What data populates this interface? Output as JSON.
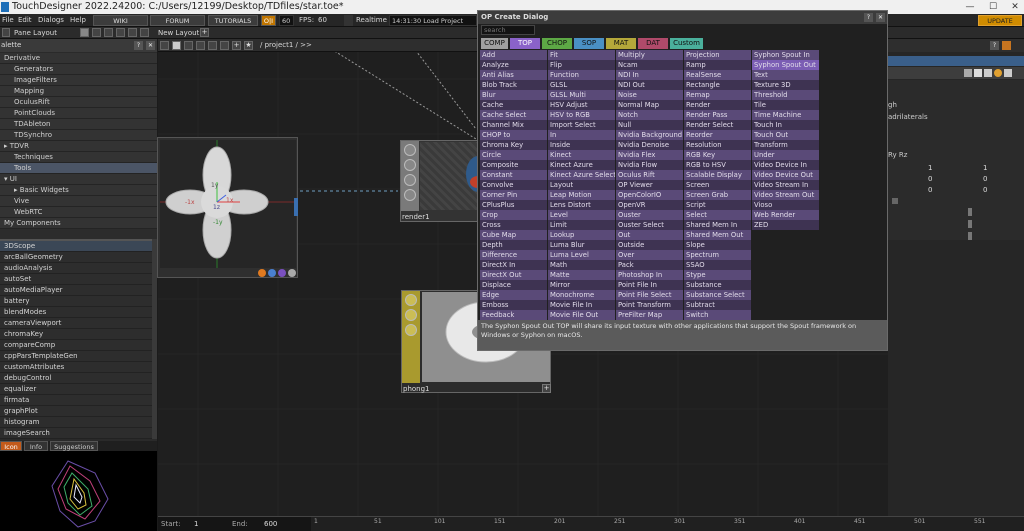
{
  "window": {
    "title": "TouchDesigner 2022.24200: C:/Users/12199/Desktop/TDfiles/star.toe*",
    "minimize": "—",
    "maximize": "☐"
  },
  "menubar": {
    "items": [
      "File",
      "Edit",
      "Dialogs",
      "Help"
    ],
    "wiki": "WIKI",
    "forum": "FORUM",
    "tutorials": "TUTORIALS",
    "oi": "O|I",
    "fps_box": "60",
    "fps": "FPS:",
    "fps_value": "60",
    "realtime": "Realtime",
    "clock": "14:31:30 Load Project .toe",
    "update": "UPDATE"
  },
  "panebar": {
    "pane_layout": "Pane Layout",
    "new_layout": "New Layout",
    "path": "/ project1 / >>"
  },
  "palette": {
    "title": "alette",
    "tree": [
      {
        "label": "Derivative",
        "indent": 0
      },
      {
        "label": "Generators",
        "indent": 1
      },
      {
        "label": "ImageFilters",
        "indent": 1
      },
      {
        "label": "Mapping",
        "indent": 1
      },
      {
        "label": "OculusRift",
        "indent": 1
      },
      {
        "label": "PointClouds",
        "indent": 1
      },
      {
        "label": "TDAbleton",
        "indent": 1
      },
      {
        "label": "TDSynchro",
        "indent": 1
      },
      {
        "label": "▸ TDVR",
        "indent": 0
      },
      {
        "label": "Techniques",
        "indent": 1
      },
      {
        "label": "Tools",
        "indent": 1
      },
      {
        "label": "▾ UI",
        "indent": 0
      },
      {
        "label": "▸ Basic Widgets",
        "indent": 1
      },
      {
        "label": "Vive",
        "indent": 1
      },
      {
        "label": "WebRTC",
        "indent": 1
      },
      {
        "label": "My Components",
        "indent": 0
      }
    ],
    "components": [
      "3DScope",
      "arcBallGeometry",
      "audioAnalysis",
      "autoSet",
      "autoMediaPlayer",
      "battery",
      "blendModes",
      "cameraViewport",
      "chromaKey",
      "compareComp",
      "cppParsTemplateGen",
      "customAttributes",
      "debugControl",
      "equalizer",
      "firmata",
      "graphPlot",
      "histogram",
      "imageSearch"
    ],
    "tabs": [
      "Icon",
      "Info",
      "Suggestions"
    ]
  },
  "nodes": {
    "render": "render1",
    "phong": "phong1",
    "axis_labels": [
      "1y",
      "-1x",
      "1z",
      "-1y",
      "1x"
    ]
  },
  "dialog": {
    "title": "OP Create Dialog",
    "search_placeholder": "search",
    "tabs": [
      "COMP",
      "TOP",
      "CHOP",
      "SOP",
      "MAT",
      "DAT",
      "Custom"
    ],
    "columns": [
      [
        "Add",
        "Analyze",
        "Anti Alias",
        "Blob Track",
        "Blur",
        "Cache",
        "Cache Select",
        "Channel Mix",
        "CHOP to",
        "Chroma Key",
        "Circle",
        "Composite",
        "Constant",
        "Convolve",
        "Corner Pin",
        "CPlusPlus",
        "Crop",
        "Cross",
        "Cube Map",
        "Depth",
        "Difference",
        "DirectX In",
        "DirectX Out",
        "Displace",
        "Edge",
        "Emboss",
        "Feedback"
      ],
      [
        "Fit",
        "Flip",
        "Function",
        "GLSL",
        "GLSL Multi",
        "HSV Adjust",
        "HSV to RGB",
        "Import Select",
        "In",
        "Inside",
        "Kinect",
        "Kinect Azure",
        "Kinect Azure Select",
        "Layout",
        "Leap Motion",
        "Lens Distort",
        "Level",
        "Limit",
        "Lookup",
        "Luma Blur",
        "Luma Level",
        "Math",
        "Matte",
        "Mirror",
        "Monochrome",
        "Movie File In",
        "Movie File Out"
      ],
      [
        "Multiply",
        "Ncam",
        "NDI In",
        "NDI Out",
        "Noise",
        "Normal Map",
        "Notch",
        "Null",
        "Nvidia Background",
        "Nvidia Denoise",
        "Nvidia Flex",
        "Nvidia Flow",
        "Oculus Rift",
        "OP Viewer",
        "OpenColorIO",
        "OpenVR",
        "Ouster",
        "Ouster Select",
        "Out",
        "Outside",
        "Over",
        "Pack",
        "Photoshop In",
        "Point File In",
        "Point File Select",
        "Point Transform",
        "PreFilter Map"
      ],
      [
        "Projection",
        "Ramp",
        "RealSense",
        "Rectangle",
        "Remap",
        "Render",
        "Render Pass",
        "Render Select",
        "Reorder",
        "Resolution",
        "RGB Key",
        "RGB to HSV",
        "Scalable Display",
        "Screen",
        "Screen Grab",
        "Script",
        "Select",
        "Shared Mem In",
        "Shared Mem Out",
        "Slope",
        "Spectrum",
        "SSAO",
        "Stype",
        "Substance",
        "Substance Select",
        "Subtract",
        "Switch"
      ],
      [
        "Syphon Spout In",
        "Syphon Spout Out",
        "Text",
        "Texture 3D",
        "Threshold",
        "Tile",
        "Time Machine",
        "Touch In",
        "Touch Out",
        "Transform",
        "Under",
        "Video Device In",
        "Video Device Out",
        "Video Stream In",
        "Video Stream Out",
        "Vioso",
        "Web Render",
        "ZED"
      ]
    ],
    "description": "The Syphon Spout Out TOP will share its input texture with other applications that support the Spout framework on Windows or Syphon on macOS."
  },
  "rightpanel": {
    "rows": [
      "gh",
      "adrilaterals",
      "",
      "Ry Rz"
    ],
    "values": [
      [
        "1",
        "1"
      ],
      [
        "0",
        "0"
      ],
      [
        "0",
        "0"
      ]
    ]
  },
  "timeline": {
    "start_label": "Start:",
    "start_value": "1",
    "end_label": "End:",
    "end_value": "600",
    "ticks": [
      "1",
      "51",
      "101",
      "151",
      "201",
      "251",
      "301",
      "351",
      "401",
      "451",
      "501",
      "551"
    ]
  },
  "colors": {
    "top_tab": "#8a62c9",
    "selected_op": "#7b5db4",
    "cell_light": "#5a4a78",
    "cell_dark": "#3e3352",
    "update": "#d08c00"
  }
}
